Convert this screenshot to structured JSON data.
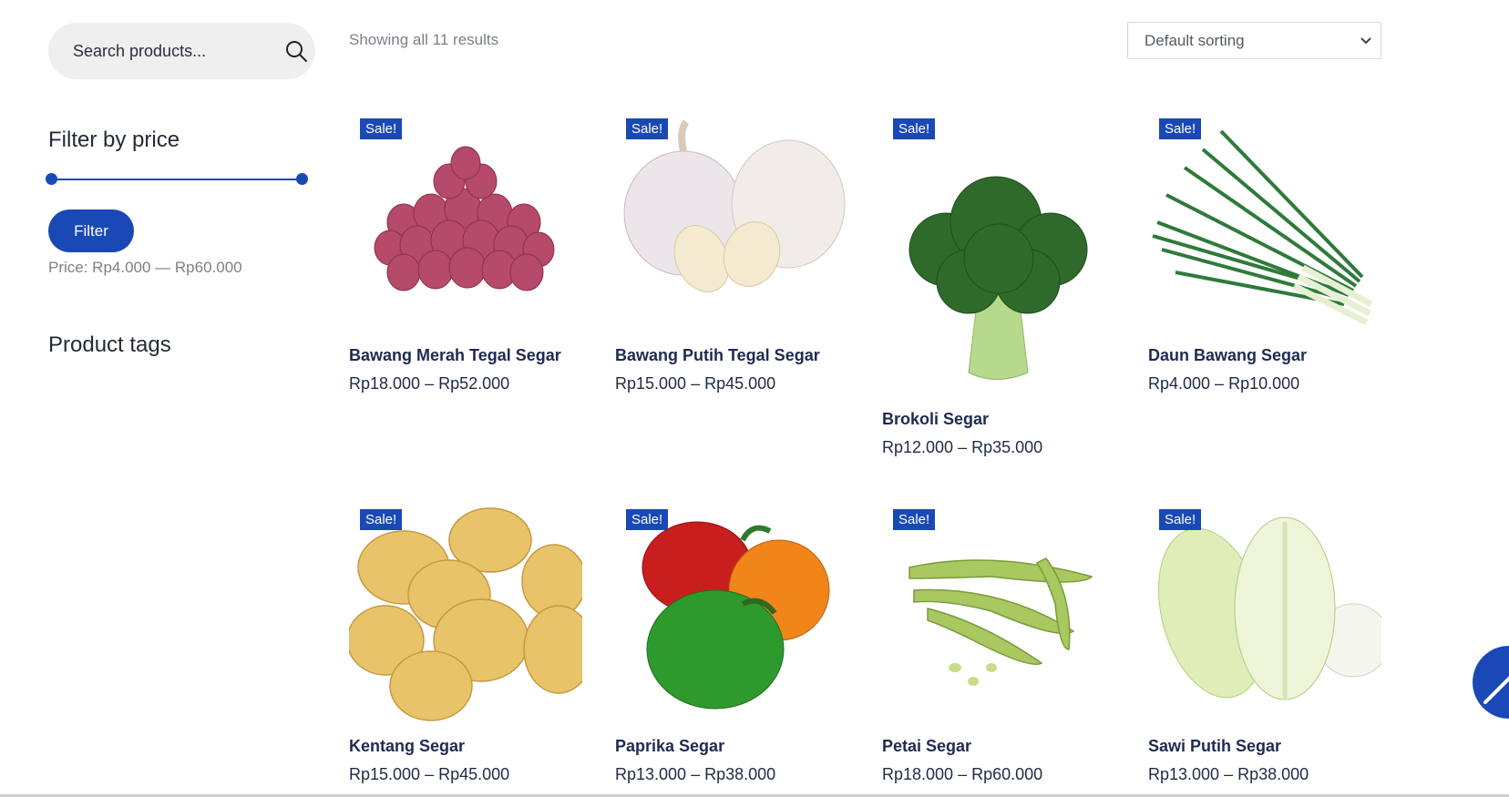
{
  "search": {
    "placeholder": "Search products..."
  },
  "filter": {
    "title": "Filter by price",
    "button": "Filter",
    "price_label": "Price: Rp4.000 — Rp60.000"
  },
  "tags": {
    "title": "Product tags"
  },
  "toolbar": {
    "result_count": "Showing all 11 results",
    "sort_selected": "Default sorting"
  },
  "colors": {
    "accent": "#1a49b5",
    "title": "#1f2a52"
  },
  "products": [
    {
      "name": "Bawang Merah Tegal Segar",
      "price": "Rp18.000 – Rp52.000",
      "badge": "Sale!"
    },
    {
      "name": "Bawang Putih Tegal Segar",
      "price": "Rp15.000 – Rp45.000",
      "badge": "Sale!"
    },
    {
      "name": "Brokoli Segar",
      "price": "Rp12.000 – Rp35.000",
      "badge": "Sale!"
    },
    {
      "name": "Daun Bawang Segar",
      "price": "Rp4.000 – Rp10.000",
      "badge": "Sale!"
    },
    {
      "name": "Kentang Segar",
      "price": "Rp15.000 – Rp45.000",
      "badge": "Sale!"
    },
    {
      "name": "Paprika Segar",
      "price": "Rp13.000 – Rp38.000",
      "badge": "Sale!"
    },
    {
      "name": "Petai Segar",
      "price": "Rp18.000 – Rp60.000",
      "badge": "Sale!"
    },
    {
      "name": "Sawi Putih Segar",
      "price": "Rp13.000 – Rp38.000",
      "badge": "Sale!"
    }
  ]
}
